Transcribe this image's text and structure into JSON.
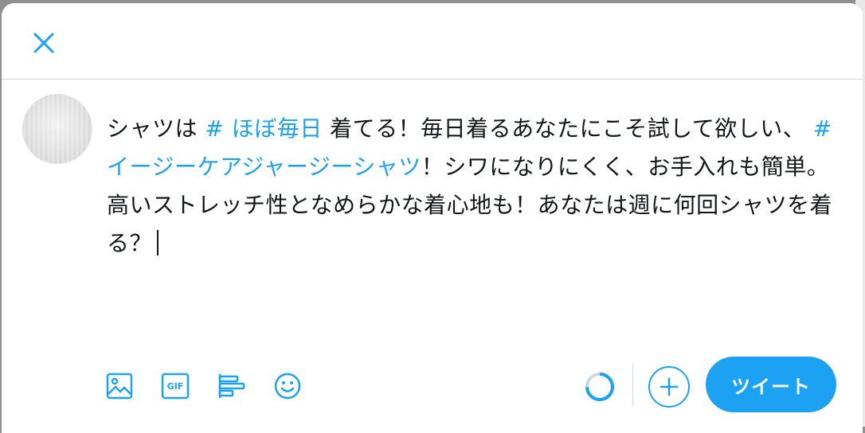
{
  "compose": {
    "text_segments": [
      {
        "text": "シャツは ",
        "type": "text"
      },
      {
        "text": "# ほぼ毎日",
        "type": "hashtag"
      },
      {
        "text": " 着てる！毎日着るあなたにこそ試して欲しい、 ",
        "type": "text"
      },
      {
        "text": "#イージーケアジャージーシャツ",
        "type": "hashtag"
      },
      {
        "text": "！シワになりにくく、お手入れも簡単。 高いストレッチ性となめらかな着心地も！あなたは週に何回シャツを着る？",
        "type": "text"
      }
    ]
  },
  "toolbar": {
    "icons": [
      "image-icon",
      "gif-icon",
      "poll-icon",
      "emoji-icon"
    ],
    "gif_label": "GIF"
  },
  "actions": {
    "tweet_label": "ツイート"
  },
  "colors": {
    "accent": "#1da1f2",
    "text": "#14171a",
    "divider": "#cdd7df"
  }
}
